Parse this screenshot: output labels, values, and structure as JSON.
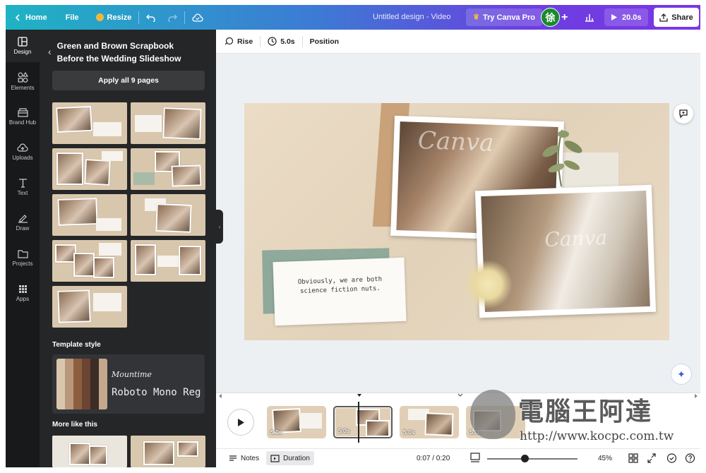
{
  "topbar": {
    "home": "Home",
    "file": "File",
    "resize": "Resize",
    "title": "Untitled design - Video",
    "try_pro": "Try Canva Pro",
    "avatar": "徐",
    "duration": "20.0s",
    "share": "Share"
  },
  "rail": {
    "items": [
      {
        "label": "Design",
        "icon": "design-icon"
      },
      {
        "label": "Elements",
        "icon": "elements-icon"
      },
      {
        "label": "Brand Hub",
        "icon": "brand-hub-icon"
      },
      {
        "label": "Uploads",
        "icon": "upload-icon"
      },
      {
        "label": "Text",
        "icon": "text-icon"
      },
      {
        "label": "Draw",
        "icon": "draw-icon"
      },
      {
        "label": "Projects",
        "icon": "folder-icon"
      },
      {
        "label": "Apps",
        "icon": "apps-icon"
      }
    ]
  },
  "panel": {
    "title_line1": "Green and Brown Scrapbook",
    "title_line2": "Before the Wedding Slideshow",
    "apply": "Apply all 9 pages",
    "template_style": "Template style",
    "style_script": "Mountime",
    "style_mono": "Roboto Mono Reg",
    "swatches": [
      "#d9c6ad",
      "#b8977a",
      "#8c5e3f",
      "#6b4432",
      "#3b2c26",
      "#c3a88c"
    ],
    "more_like_this": "More like this"
  },
  "context_toolbar": {
    "animation": "Rise",
    "duration": "5.0s",
    "position": "Position"
  },
  "canvas": {
    "note_text": "Obviously, we are both science fiction nuts.",
    "watermark": "Canva"
  },
  "timeline": {
    "clips": [
      {
        "duration": "5.0s"
      },
      {
        "duration": "5.0s"
      },
      {
        "duration": "5.0s"
      },
      {
        "duration": "5.0s"
      }
    ]
  },
  "footer": {
    "notes": "Notes",
    "duration": "Duration",
    "time": "0:07 / 0:20",
    "zoom": "45%"
  },
  "overlay": {
    "site_title": "電腦王阿達",
    "site_url": "http://www.kocpc.com.tw"
  },
  "colors": {
    "accent_start": "#1fb3c4",
    "accent_end": "#7a36e6",
    "panel_bg": "#252627",
    "rail_bg": "#18191b"
  }
}
